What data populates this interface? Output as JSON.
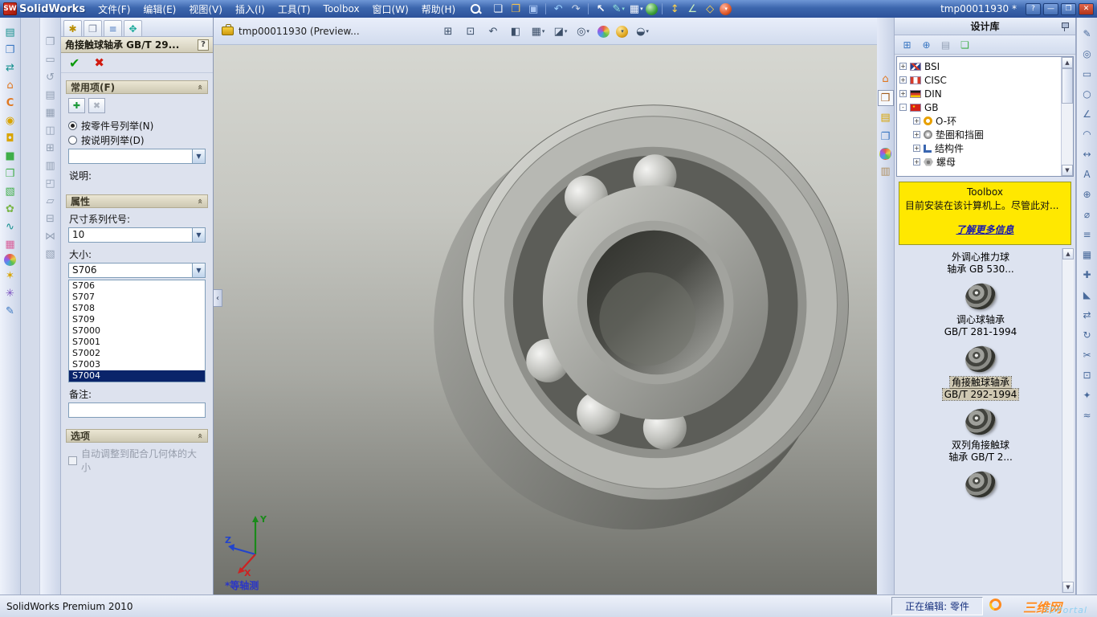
{
  "titlebar": {
    "logo_text": "SW",
    "app_name": "SolidWorks",
    "menus": [
      {
        "label": "文件(F)"
      },
      {
        "label": "编辑(E)"
      },
      {
        "label": "视图(V)"
      },
      {
        "label": "插入(I)"
      },
      {
        "label": "工具(T)"
      },
      {
        "label": "Toolbox"
      },
      {
        "label": "窗口(W)"
      },
      {
        "label": "帮助(H)"
      }
    ],
    "tools": [
      {
        "name": "new-document-icon",
        "glyph": "❏",
        "cls": "ic-new"
      },
      {
        "name": "open-icon",
        "glyph": "❒",
        "cls": "ic-open"
      },
      {
        "name": "save-icon",
        "glyph": "▣",
        "cls": "ic-save"
      },
      {
        "name": "toolbar-separator",
        "glyph": "",
        "cls": "tsep",
        "inter": "false"
      },
      {
        "name": "undo-icon",
        "glyph": "↶",
        "cls": "ic-undo"
      },
      {
        "name": "redo-icon",
        "glyph": "↷",
        "cls": "ic-redo"
      },
      {
        "name": "toolbar-separator",
        "glyph": "",
        "cls": "tsep",
        "inter": "false"
      },
      {
        "name": "select-arrow-icon",
        "glyph": "↖",
        "cls": "ic-select"
      },
      {
        "name": "sketch-icon",
        "glyph": "✎",
        "cls": "ic-sketch dd"
      },
      {
        "name": "view-cube-icon",
        "glyph": "▦",
        "cls": "ic-plusgrid dd"
      },
      {
        "name": "globe-icon",
        "glyph": "",
        "cls": "sphere-green"
      },
      {
        "name": "toolbar-separator",
        "glyph": "",
        "cls": "tsep",
        "inter": "false"
      },
      {
        "name": "vertical-arrows-icon",
        "glyph": "↕",
        "cls": "ic-updown"
      },
      {
        "name": "measure-icon",
        "glyph": "∠",
        "cls": "ic-angle"
      },
      {
        "name": "mate-icon",
        "glyph": "◇",
        "cls": "ic-diamond"
      },
      {
        "name": "toolbox-ball-icon",
        "glyph": "",
        "cls": "sphere-red dd"
      }
    ],
    "doc_title": "tmp00011930 *",
    "help_btn": "?",
    "min_btn": "—",
    "max_btn": "❐",
    "close_btn": "✕"
  },
  "left_toolbar_a": [
    {
      "name": "clipboard-icon",
      "glyph": "▤",
      "cls": "c-teal"
    },
    {
      "name": "window-icon",
      "glyph": "❐",
      "cls": "c-blue"
    },
    {
      "name": "swap-arrows-icon",
      "glyph": "⇄",
      "cls": "c-teal"
    },
    {
      "name": "home-icon",
      "glyph": "⌂",
      "cls": "c-orange"
    },
    {
      "name": "letter-c-icon",
      "glyph": "C",
      "cls": "c-orange bold"
    },
    {
      "name": "bell-icon",
      "glyph": "◉",
      "cls": "c-gold"
    },
    {
      "name": "lock-icon",
      "glyph": "◘",
      "cls": "c-gold"
    },
    {
      "name": "green-square-icon",
      "glyph": "■",
      "cls": "c-green"
    },
    {
      "name": "folders-icon",
      "glyph": "❒",
      "cls": "c-green"
    },
    {
      "name": "cube-icon",
      "glyph": "▧",
      "cls": "c-green"
    },
    {
      "name": "leaf-icon",
      "glyph": "✿",
      "cls": "c-leaf"
    },
    {
      "name": "spline-icon",
      "glyph": "∿",
      "cls": "c-teal"
    },
    {
      "name": "grid-icon",
      "glyph": "▦",
      "cls": "c-pink"
    },
    {
      "name": "sphere-icon",
      "glyph": "",
      "cls": "sphere-multi"
    },
    {
      "name": "star-icon",
      "glyph": "✶",
      "cls": "c-gold"
    },
    {
      "name": "asterisk-icon",
      "glyph": "✳",
      "cls": "c-purple"
    },
    {
      "name": "pencil-icon",
      "glyph": "✎",
      "cls": "c-blue"
    }
  ],
  "left_toolbar_b": [
    {
      "name": "window-icon",
      "glyph": "❐",
      "cls": ""
    },
    {
      "name": "sheet-icon",
      "glyph": "▭",
      "cls": ""
    },
    {
      "name": "rotate-icon",
      "glyph": "↺",
      "cls": ""
    },
    {
      "name": "list-icon",
      "glyph": "▤",
      "cls": ""
    },
    {
      "name": "grid-icon",
      "glyph": "▦",
      "cls": ""
    },
    {
      "name": "columns-icon",
      "glyph": "◫",
      "cls": ""
    },
    {
      "name": "plus-box-icon",
      "glyph": "⊞",
      "cls": ""
    },
    {
      "name": "rows-icon",
      "glyph": "▥",
      "cls": ""
    },
    {
      "name": "corner-box-icon",
      "glyph": "◰",
      "cls": ""
    },
    {
      "name": "parallelogram-icon",
      "glyph": "▱",
      "cls": ""
    },
    {
      "name": "minus-box-icon",
      "glyph": "⊟",
      "cls": ""
    },
    {
      "name": "bowtie-icon",
      "glyph": "⋈",
      "cls": ""
    },
    {
      "name": "hatch-icon",
      "glyph": "▧",
      "cls": ""
    }
  ],
  "pm": {
    "tabs": [
      {
        "name": "properties-tab-icon",
        "glyph": "✱",
        "cls": "t-gold"
      },
      {
        "name": "appearances-tab-icon",
        "glyph": "❐",
        "cls": "t-gray"
      },
      {
        "name": "configuration-tab-icon",
        "glyph": "≡",
        "cls": "t-blue"
      },
      {
        "name": "move-tab-icon",
        "glyph": "✥",
        "cls": "t-teal"
      }
    ],
    "title": "角接触球轴承 GB/T 29...",
    "help": "?",
    "ok": "✔",
    "cancel": "✖",
    "chevron": "«",
    "dropdown_arrow": "▼",
    "collapse_glyph": "‹",
    "group_common": "常用项(F)",
    "fav_add_glyph": "✚",
    "fav_del_glyph": "✖",
    "radio_by_number": "按零件号列举(N)",
    "radio_by_desc": "按说明列举(D)",
    "desc_label": "说明:",
    "group_props": "属性",
    "series_label": "尺寸系列代号:",
    "series_value": "10",
    "size_label": "大小:",
    "size_value": "S706",
    "size_options": [
      {
        "label": "S706"
      },
      {
        "label": "S707"
      },
      {
        "label": "S708"
      },
      {
        "label": "S709"
      },
      {
        "label": "S7000"
      },
      {
        "label": "S7001"
      },
      {
        "label": "S7002"
      },
      {
        "label": "S7003"
      },
      {
        "label": "S7004",
        "sel": true
      }
    ],
    "remark_label": "备注:",
    "group_options": "选项",
    "autosize_label": "自动调整到配合几何体的大小"
  },
  "viewport": {
    "doc_tab": "tmp00011930  (Preview...",
    "hud": [
      {
        "name": "zoom-fit-icon",
        "glyph": "⊞",
        "cls": ""
      },
      {
        "name": "zoom-area-icon",
        "glyph": "⊡",
        "cls": ""
      },
      {
        "name": "previous-view-icon",
        "glyph": "↶",
        "cls": ""
      },
      {
        "name": "section-view-icon",
        "glyph": "◧",
        "cls": ""
      },
      {
        "name": "view-orientation-icon",
        "glyph": "▦",
        "cls": "dd"
      },
      {
        "name": "display-style-icon",
        "glyph": "◪",
        "cls": "dd"
      },
      {
        "name": "hide-show-items-icon",
        "glyph": "◎",
        "cls": "dd"
      },
      {
        "name": "edit-appearance-icon",
        "glyph": "",
        "cls": "sphere-multi"
      },
      {
        "name": "apply-scene-icon",
        "glyph": "",
        "cls": "sphere-gold dd"
      },
      {
        "name": "view-settings-icon",
        "glyph": "◒",
        "cls": "dd"
      }
    ],
    "view_label": "*等轴测",
    "axis_x": "X",
    "axis_y": "Y",
    "axis_z": "Z"
  },
  "taskpane": [
    {
      "name": "home-icon",
      "glyph": "⌂",
      "cls": "c-orange"
    },
    {
      "name": "design-library-icon",
      "glyph": "❒",
      "cls": "c-brown pressed"
    },
    {
      "name": "file-explorer-icon",
      "glyph": "▤",
      "cls": "c-gold"
    },
    {
      "name": "view-palette-icon",
      "glyph": "❐",
      "cls": "c-blue"
    },
    {
      "name": "appearances-icon",
      "glyph": "",
      "cls": "sphere-multi"
    },
    {
      "name": "custom-properties-icon",
      "glyph": "▥",
      "cls": "c-tan"
    }
  ],
  "library": {
    "title": "设计库",
    "scroll_up": "▲",
    "scroll_down": "▼",
    "toolbar": [
      {
        "name": "add-to-library-icon",
        "glyph": "⊞",
        "cls": "c-blue"
      },
      {
        "name": "add-file-location-icon",
        "glyph": "⊕",
        "cls": "c-blue"
      },
      {
        "name": "new-folder-icon",
        "glyph": "▤",
        "cls": "c-grayic"
      },
      {
        "name": "document-icon",
        "glyph": "❏",
        "cls": "c-green"
      }
    ],
    "tree": [
      {
        "expand": "+",
        "label": "BSI"
      },
      {
        "expand": "+",
        "label": "CISC"
      },
      {
        "expand": "+",
        "label": "DIN"
      },
      {
        "expand": "-",
        "label": "GB"
      },
      {
        "expand": "+",
        "label": "O-环"
      },
      {
        "expand": "+",
        "label": "垫圈和挡圈"
      },
      {
        "expand": "+",
        "label": "结构件"
      },
      {
        "expand": "+",
        "label": "螺母"
      }
    ],
    "notice": {
      "title": "Toolbox",
      "body": "目前安装在该计算机上。尽管此对...",
      "link": "了解更多信息"
    },
    "items": [
      {
        "line1": "外调心推力球",
        "line2": "轴承 GB 530..."
      },
      {
        "line1": "调心球轴承",
        "line2": "GB/T 281-1994"
      },
      {
        "line1": "角接触球轴承",
        "line2": "GB/T 292-1994",
        "selected": true
      },
      {
        "line1": "双列角接触球",
        "line2": "轴承 GB/T 2..."
      }
    ]
  },
  "right_toolbar": [
    {
      "name": "pencil-icon",
      "glyph": "✎"
    },
    {
      "name": "circle-target-icon",
      "glyph": "◎"
    },
    {
      "name": "rectangle-icon",
      "glyph": "▭"
    },
    {
      "name": "circle-icon",
      "glyph": "○"
    },
    {
      "name": "angle-icon",
      "glyph": "∠"
    },
    {
      "name": "arc-icon",
      "glyph": "◠"
    },
    {
      "name": "horizontal-dimension-icon",
      "glyph": "↔"
    },
    {
      "name": "text-icon",
      "glyph": "A"
    },
    {
      "name": "circled-plus-icon",
      "glyph": "⊕"
    },
    {
      "name": "diameter-icon",
      "glyph": "⌀"
    },
    {
      "name": "lines-icon",
      "glyph": "≡"
    },
    {
      "name": "grid-icon",
      "glyph": "▦"
    },
    {
      "name": "plus-icon",
      "glyph": "✚"
    },
    {
      "name": "triangle-icon",
      "glyph": "◣"
    },
    {
      "name": "swap-arrows-icon",
      "glyph": "⇄"
    },
    {
      "name": "rotate-icon",
      "glyph": "↻"
    },
    {
      "name": "trim-icon",
      "glyph": "✂"
    },
    {
      "name": "boxed-plus-icon",
      "glyph": "⊡"
    },
    {
      "name": "spark-icon",
      "glyph": "✦"
    },
    {
      "name": "wave-icon",
      "glyph": "≈"
    }
  ],
  "statusbar": {
    "product": "SolidWorks Premium 2010",
    "editing": "正在编辑: 零件",
    "watermark_cn": "三维网",
    "watermark_en": "3DPortal"
  }
}
